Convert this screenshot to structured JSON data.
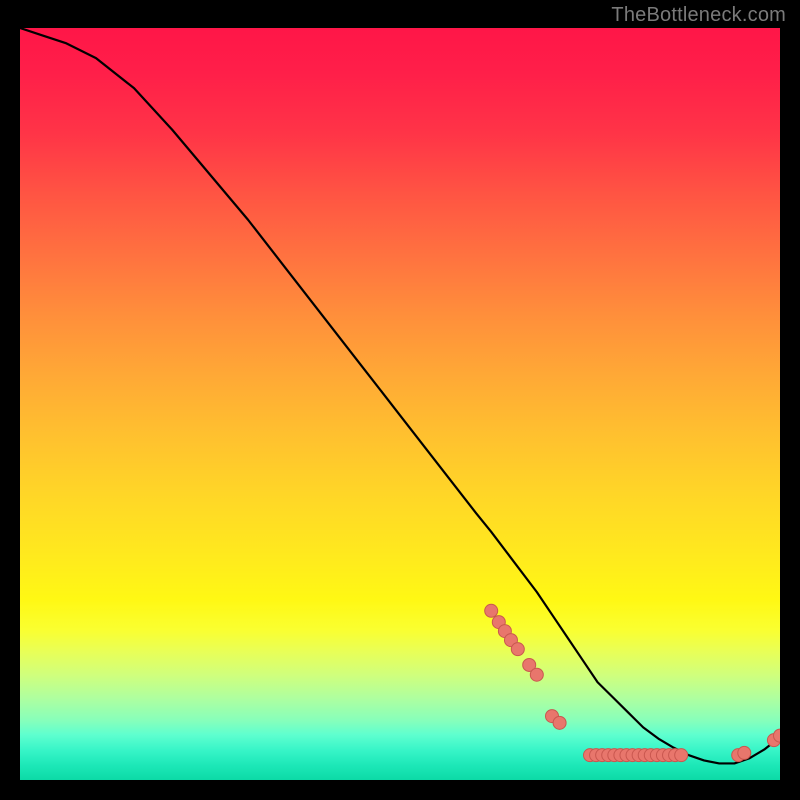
{
  "attribution": "TheBottleneck.com",
  "colors": {
    "background": "#000000",
    "curve_stroke": "#000000",
    "marker_fill": "#e8766c",
    "marker_stroke": "#c9574f",
    "attribution_text": "#7a7a7a"
  },
  "chart_data": {
    "type": "line",
    "title": "",
    "xlabel": "",
    "ylabel": "",
    "xlim": [
      0,
      100
    ],
    "ylim": [
      0,
      100
    ],
    "grid": false,
    "curve": {
      "x": [
        0,
        3,
        6,
        10,
        15,
        20,
        25,
        30,
        35,
        40,
        45,
        50,
        55,
        60,
        62,
        65,
        68,
        70,
        72,
        74,
        76,
        78,
        80,
        82,
        84,
        86,
        88,
        90,
        92,
        94,
        96,
        98,
        100
      ],
      "y": [
        100,
        99,
        98,
        96,
        92,
        86.5,
        80.5,
        74.5,
        68,
        61.5,
        55,
        48.5,
        42,
        35.5,
        33,
        29,
        25,
        22,
        19,
        16,
        13,
        11,
        9,
        7,
        5.5,
        4.3,
        3.3,
        2.6,
        2.2,
        2.2,
        2.9,
        4.1,
        5.7
      ]
    },
    "markers_cluster_a": {
      "name": "cluster-left",
      "points": [
        {
          "x": 62,
          "y": 22.5
        },
        {
          "x": 63,
          "y": 21.0
        },
        {
          "x": 63.8,
          "y": 19.8
        },
        {
          "x": 64.6,
          "y": 18.6
        },
        {
          "x": 65.5,
          "y": 17.4
        },
        {
          "x": 67.0,
          "y": 15.3
        },
        {
          "x": 68.0,
          "y": 14.0
        }
      ]
    },
    "markers_cluster_b": {
      "name": "cluster-mid",
      "points": [
        {
          "x": 70,
          "y": 8.5
        },
        {
          "x": 71,
          "y": 7.6
        }
      ]
    },
    "markers_cluster_c": {
      "name": "cluster-valley",
      "points": [
        {
          "x": 75,
          "y": 3.3
        },
        {
          "x": 75.8,
          "y": 3.3
        },
        {
          "x": 76.6,
          "y": 3.3
        },
        {
          "x": 77.4,
          "y": 3.3
        },
        {
          "x": 78.2,
          "y": 3.3
        },
        {
          "x": 79.0,
          "y": 3.3
        },
        {
          "x": 79.8,
          "y": 3.3
        },
        {
          "x": 80.6,
          "y": 3.3
        },
        {
          "x": 81.4,
          "y": 3.3
        },
        {
          "x": 82.2,
          "y": 3.3
        },
        {
          "x": 83.0,
          "y": 3.3
        },
        {
          "x": 83.8,
          "y": 3.3
        },
        {
          "x": 84.6,
          "y": 3.3
        },
        {
          "x": 85.4,
          "y": 3.3
        },
        {
          "x": 86.2,
          "y": 3.3
        },
        {
          "x": 87.0,
          "y": 3.3
        }
      ]
    },
    "markers_cluster_d": {
      "name": "cluster-right",
      "points": [
        {
          "x": 94.5,
          "y": 3.3
        },
        {
          "x": 95.3,
          "y": 3.6
        }
      ]
    },
    "markers_cluster_e": {
      "name": "cluster-tail",
      "points": [
        {
          "x": 99.2,
          "y": 5.3
        },
        {
          "x": 100,
          "y": 5.9
        }
      ]
    }
  }
}
